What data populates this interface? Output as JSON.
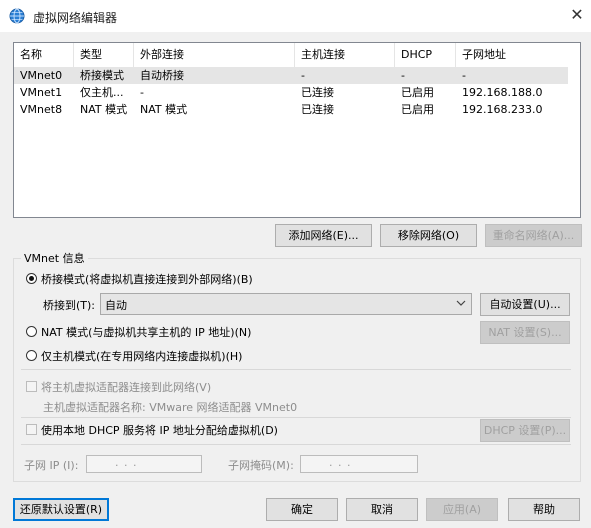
{
  "window": {
    "title": "虚拟网络编辑器",
    "close_glyph": "✕",
    "icon": "globe-icon"
  },
  "table": {
    "columns": [
      "名称",
      "类型",
      "外部连接",
      "主机连接",
      "DHCP",
      "子网地址"
    ],
    "rows": [
      [
        "VMnet0",
        "桥接模式",
        "自动桥接",
        "-",
        "-",
        "-"
      ],
      [
        "VMnet1",
        "仅主机...",
        "-",
        "已连接",
        "已启用",
        "192.168.188.0"
      ],
      [
        "VMnet8",
        "NAT 模式",
        "NAT 模式",
        "已连接",
        "已启用",
        "192.168.233.0"
      ]
    ],
    "selected_row": 0
  },
  "net_buttons": {
    "add": "添加网络(E)...",
    "remove": "移除网络(O)",
    "rename": "重命名网络(A)..."
  },
  "info": {
    "legend": "VMnet 信息",
    "bridge_label": "桥接模式(将虚拟机直接连接到外部网络)(B)",
    "bridge_to_label": "桥接到(T):",
    "bridge_to_value": "自动",
    "auto_settings": "自动设置(U)...",
    "nat_label": "NAT 模式(与虚拟机共享主机的 IP 地址)(N)",
    "nat_settings": "NAT 设置(S)...",
    "hostonly_label": "仅主机模式(在专用网络内连接虚拟机)(H)",
    "connect_adapter_label": "将主机虚拟适配器连接到此网络(V)",
    "adapter_name_label": "主机虚拟适配器名称: VMware 网络适配器 VMnet0",
    "dhcp_label": "使用本地 DHCP 服务将 IP 地址分配给虚拟机(D)",
    "dhcp_settings": "DHCP 设置(P)...",
    "subnet_ip_label": "子网 IP (I):",
    "subnet_ip_value": ".       .       .",
    "subnet_mask_label": "子网掩码(M):",
    "subnet_mask_value": ".       .       ."
  },
  "footer": {
    "restore": "还原默认设置(R)",
    "ok": "确定",
    "cancel": "取消",
    "apply": "应用(A)",
    "help": "帮助"
  },
  "colors": {
    "accent": "#0078d7",
    "selected_row": "#e5e5e5"
  }
}
